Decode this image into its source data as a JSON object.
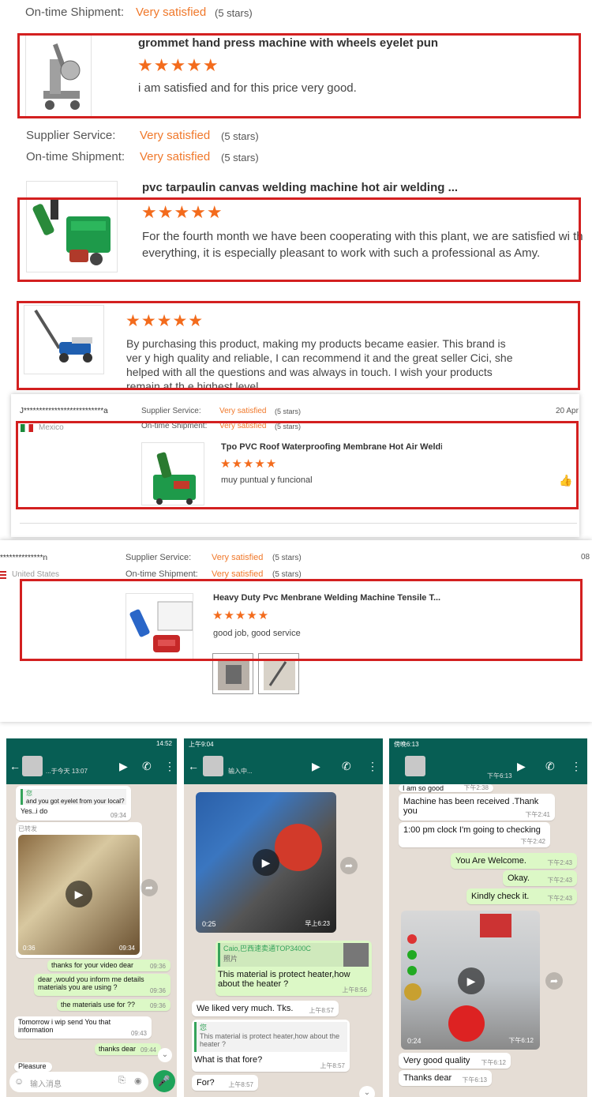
{
  "review0": {
    "ship_label": "On-time Shipment:",
    "ship_value": "Very satisfied",
    "ship_stars": "(5 stars)"
  },
  "review1": {
    "title": "grommet hand press machine with wheels eyelet pun...",
    "stars": "★★★★★",
    "text": "i am satisfied and for this price very good.",
    "supplier_label": "Supplier Service:",
    "supplier_value": "Very satisfied",
    "supplier_stars": "(5 stars)",
    "ship_label": "On-time Shipment:",
    "ship_value": "Very satisfied",
    "ship_stars": "(5 stars)"
  },
  "review2": {
    "title": "pvc tarpaulin canvas welding machine hot air welding ...",
    "stars": "★★★★★",
    "text": "For the fourth month we have been cooperating with this plant, we are satisfied wi th everything, it is especially pleasant to work with such a professional as Amy."
  },
  "review3": {
    "stars": "★★★★★",
    "text": "By purchasing this product, making my products became easier.  This brand is ver y high quality and reliable, I can recommend it and the great seller Cici, she helped with all the questions and was always in touch.  I wish your products remain at th e highest level"
  },
  "review4": {
    "user": "J**************************a",
    "country": "Mexico",
    "supplier_label": "Supplier Service:",
    "supplier_value": "Very satisfied",
    "supplier_stars": "(5 stars)",
    "ship_label": "On-time Shipment:",
    "ship_value": "Very satisfied",
    "ship_stars": "(5 stars)",
    "date": "20 Apr",
    "title": "Tpo PVC Roof Waterproofing Membrane Hot Air Weldi...",
    "stars": "★★★★★",
    "text": "muy puntual y funcional"
  },
  "review5": {
    "user": "**************n",
    "country": "United States",
    "supplier_label": "Supplier Service:",
    "supplier_value": "Very satisfied",
    "supplier_stars": "(5 stars)",
    "ship_label": "On-time Shipment:",
    "ship_value": "Very satisfied",
    "ship_stars": "(5 stars)",
    "date": "08",
    "title": "Heavy Duty Pvc Menbrane Welding Machine Tensile T...",
    "stars": "★★★★★",
    "text": "good job, good service"
  },
  "chat1": {
    "status_time": "14:52",
    "header_sub": "...于今天 13:07",
    "quote_name": "您",
    "quote_text": "and you got eyelet from your local?",
    "msg1": "Yes..i do",
    "msg1_time": "09:34",
    "forward_label": "已转发",
    "video_duration": "0:36",
    "video_time": "09:34",
    "out1": "thanks for your video dear",
    "out1_time": "09:36",
    "out2": "dear ,would  you inform me details materials you are using ?",
    "out2_time": "09:36",
    "out3": "the materials use for ??",
    "out3_time": "09:36",
    "in2": "Tomorrow i wip send You that information",
    "in2_time": "09:43",
    "out4": "thanks dear",
    "out4_time": "09:44",
    "in3": "Pleasure",
    "input_placeholder": "输入消息"
  },
  "chat2": {
    "status_time": "上午9:04",
    "header_sub": "输入中...",
    "video_duration": "0:25",
    "video_time": "早上6:23",
    "quote_name": "Caio,巴西速卖通TOP3400C",
    "quote_sub": "照片",
    "out1": "This material is protect heater,how about the heater ?",
    "out1_time": "上午8:56",
    "in1": "We liked very much. Tks.",
    "in1_time": "上午8:57",
    "quote2_name": "您",
    "quote2_text": "This material is protect heater,how about the heater ?",
    "in2": "What is that fore?",
    "in2_time": "上午8:57",
    "in3": "For?",
    "in3_time": "上午8:57"
  },
  "chat3": {
    "status_time": "傍晚6:13",
    "header_sub": "下午6:13",
    "top_cut": "I am so good",
    "top_cut_time": "下午2:38",
    "in1": "Machine has been received .Thank you",
    "in1_time": "下午2:41",
    "in2": "1:00 pm clock I'm going to checking",
    "in2_time": "下午2:42",
    "out1": "You Are Welcome.",
    "out1_time": "下午2:43",
    "out2": "Okay.",
    "out2_time": "下午2:43",
    "out3": "Kindly check it.",
    "out3_time": "下午2:43",
    "video_duration": "0:24",
    "video_time": "下午6:12",
    "in3": "Very good quality",
    "in3_time": "下午6:12",
    "in4": "Thanks dear",
    "in4_time": "下午6:13"
  }
}
